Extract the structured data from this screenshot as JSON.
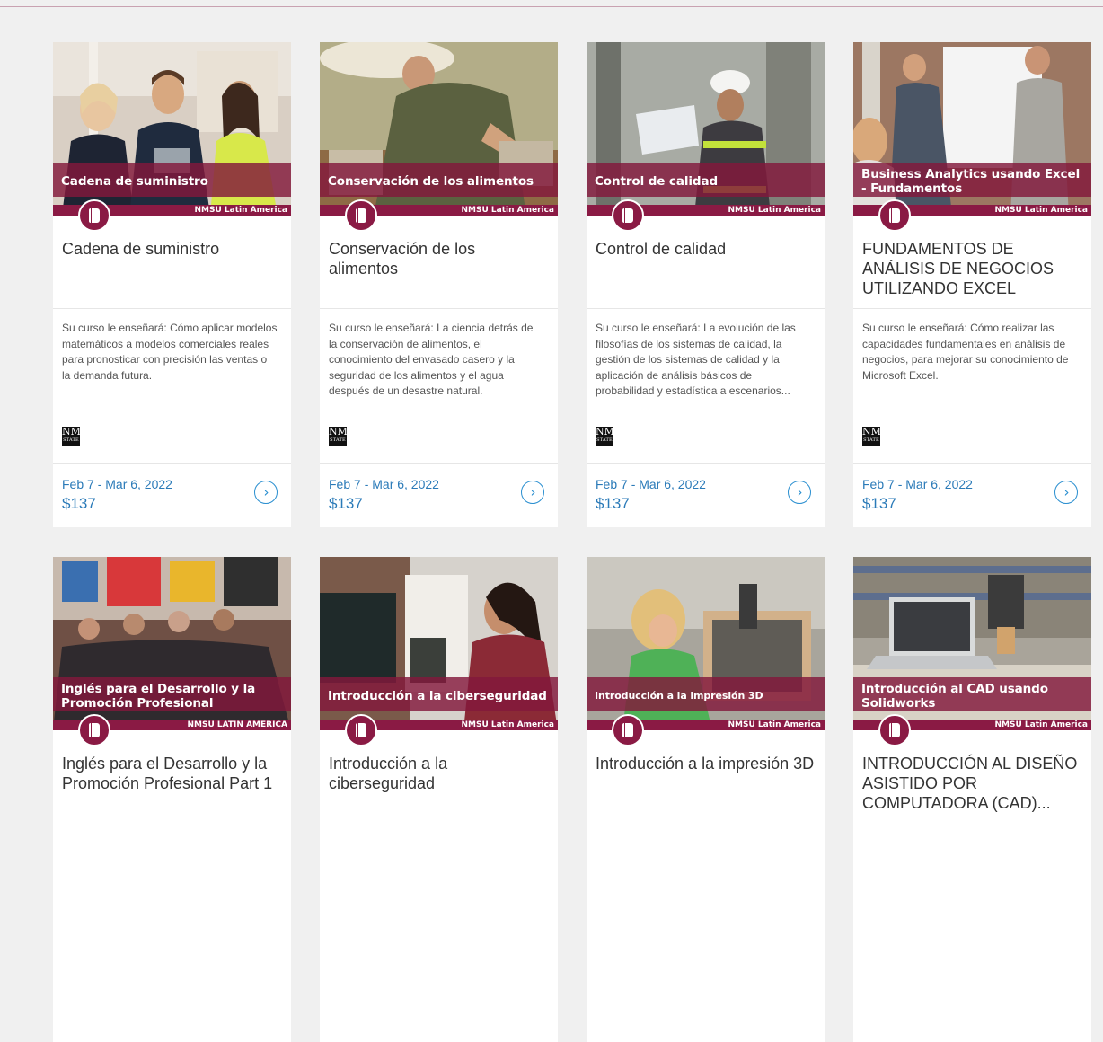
{
  "brand_color": "#8a1a44",
  "link_color": "#2a7ab8",
  "courses": [
    {
      "banner": "Cadena de suministro",
      "provider": "NMSU Latin America",
      "title": "Cadena de suministro",
      "description": "Su curso le enseñará: Cómo aplicar modelos matemáticos a modelos comerciales reales para pronosticar con precisión las ventas o la demanda futura.",
      "logo": "NM",
      "logo_sub": "STATE",
      "dates": "Feb 7 - Mar 6, 2022",
      "price": "$137",
      "arrow": "›",
      "icon": "book-icon"
    },
    {
      "banner": "Conservación de los alimentos",
      "provider": "NMSU Latin America",
      "title": "Conservación de los alimentos",
      "description": "Su curso le enseñará: La ciencia detrás de la conservación de alimentos, el conocimiento del envasado casero y la seguridad de los alimentos y el agua después de un desastre natural.",
      "logo": "NM",
      "logo_sub": "STATE",
      "dates": "Feb 7 - Mar 6, 2022",
      "price": "$137",
      "arrow": "›",
      "icon": "book-icon"
    },
    {
      "banner": "Control de calidad",
      "provider": "NMSU Latin America",
      "title": "Control de calidad",
      "description": "Su curso le enseñará: La evolución de las filosofías de los sistemas de calidad, la gestión de los sistemas de calidad y la aplicación de análisis básicos de probabilidad y estadística a escenarios...",
      "logo": "NM",
      "logo_sub": "STATE",
      "dates": "Feb 7 - Mar 6, 2022",
      "price": "$137",
      "arrow": "›",
      "icon": "book-icon"
    },
    {
      "banner": "Business Analytics usando Excel - Fundamentos",
      "provider": "NMSU Latin America",
      "title": "FUNDAMENTOS DE ANÁLISIS DE NEGOCIOS UTILIZANDO EXCEL",
      "description": "Su curso le enseñará: Cómo realizar las capacidades fundamentales en análisis de negocios, para mejorar su conocimiento de Microsoft Excel.",
      "logo": "NM",
      "logo_sub": "STATE",
      "dates": "Feb 7 - Mar 6, 2022",
      "price": "$137",
      "arrow": "›",
      "icon": "book-icon"
    },
    {
      "banner": "Inglés para el Desarrollo y la Promoción Profesional",
      "provider": "NMSU LATIN AMERICA",
      "title": "Inglés para el Desarrollo y la Promoción Profesional Part 1",
      "description": "",
      "logo": "",
      "logo_sub": "",
      "dates": "",
      "price": "",
      "arrow": "",
      "icon": "book-icon"
    },
    {
      "banner": "Introducción a la ciberseguridad",
      "provider": "NMSU Latin America",
      "title": "Introducción a la ciberseguridad",
      "description": "",
      "logo": "",
      "logo_sub": "",
      "dates": "",
      "price": "",
      "arrow": "",
      "icon": "book-icon"
    },
    {
      "banner": "Introducción a la impresión 3D",
      "provider": "NMSU Latin America",
      "title": "Introducción a la impresión 3D",
      "description": "",
      "logo": "",
      "logo_sub": "",
      "dates": "",
      "price": "",
      "arrow": "",
      "icon": "book-icon"
    },
    {
      "banner": "Introducción al CAD usando Solidworks",
      "provider": "NMSU Latin America",
      "title": "INTRODUCCIÓN AL DISEÑO ASISTIDO POR COMPUTADORA (CAD)...",
      "description": "",
      "logo": "",
      "logo_sub": "",
      "dates": "",
      "price": "",
      "arrow": "",
      "icon": "book-icon"
    }
  ]
}
